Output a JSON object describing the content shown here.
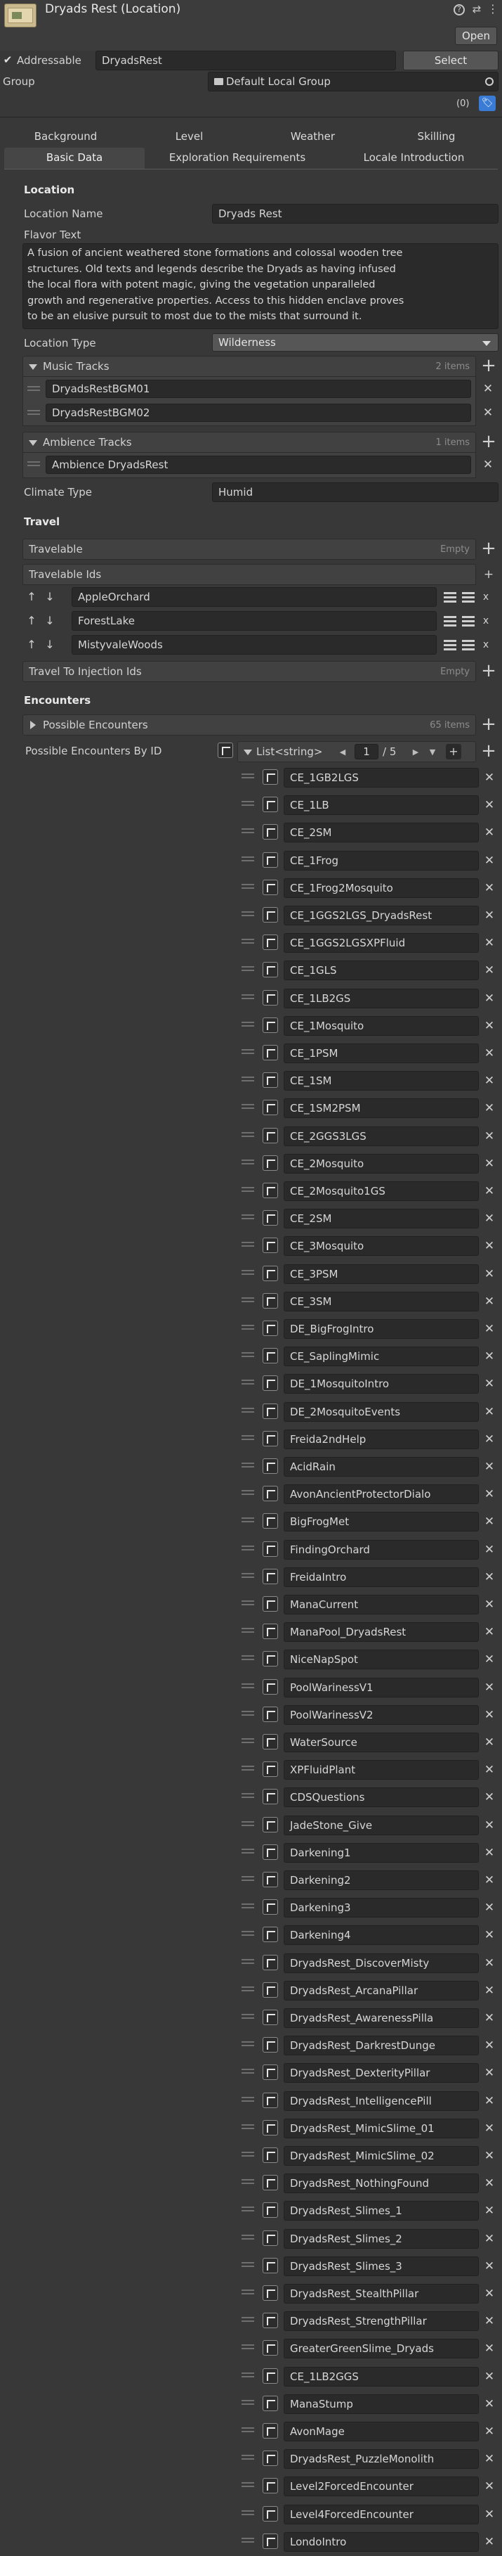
{
  "header": {
    "title": "Dryads Rest (Location)",
    "open_label": "Open"
  },
  "addressable": {
    "label": "Addressable",
    "value": "DryadsRest",
    "select_label": "Select",
    "group_label": "Group",
    "group_value": "Default Local Group",
    "badge": "(0)"
  },
  "tabs": {
    "row1": [
      "Background",
      "Level",
      "Weather",
      "Skilling"
    ],
    "row2": [
      "Basic Data",
      "Exploration Requirements",
      "Locale Introduction"
    ],
    "active": "Basic Data"
  },
  "location": {
    "header": "Location",
    "name_label": "Location Name",
    "name_value": "Dryads Rest",
    "flavor_label": "Flavor Text",
    "flavor_lines": [
      "A fusion of ancient weathered stone formations and colossal wooden tree",
      "structures. Old texts and legends describe the Dryads as having infused",
      "the local flora with potent magic, giving the vegetation unparalleled",
      "growth and regenerative properties. Access to this hidden enclave proves",
      "to be an elusive pursuit to most due to the mists that surround it."
    ],
    "type_label": "Location Type",
    "type_value": "Wilderness",
    "music_label": "Music Tracks",
    "music_count": "2 items",
    "music_items": [
      "DryadsRestBGM01",
      "DryadsRestBGM02"
    ],
    "ambience_label": "Ambience Tracks",
    "ambience_count": "1 items",
    "ambience_items": [
      "Ambience DryadsRest"
    ],
    "climate_label": "Climate Type",
    "climate_value": "Humid"
  },
  "travel": {
    "header": "Travel",
    "travelable_label": "Travelable",
    "travelable_empty": "Empty",
    "ids_label": "Travelable Ids",
    "ids": [
      "AppleOrchard",
      "ForestLake",
      "MistyvaleWoods"
    ],
    "injection_label": "Travel To Injection Ids",
    "injection_empty": "Empty"
  },
  "encounters": {
    "header": "Encounters",
    "possible_label": "Possible Encounters",
    "possible_count": "65 items",
    "by_id_label": "Possible Encounters By ID",
    "list_type": "List<string>",
    "page_current": "1",
    "page_total": "/ 5",
    "items": [
      "CE_1GB2LGS",
      "CE_1LB",
      "CE_2SM",
      "CE_1Frog",
      "CE_1Frog2Mosquito",
      "CE_1GGS2LGS_DryadsRest",
      "CE_1GGS2LGSXPFluid",
      "CE_1GLS",
      "CE_1LB2GS",
      "CE_1Mosquito",
      "CE_1PSM",
      "CE_1SM",
      "CE_1SM2PSM",
      "CE_2GGS3LGS",
      "CE_2Mosquito",
      "CE_2Mosquito1GS",
      "CE_2SM",
      "CE_3Mosquito",
      "CE_3PSM",
      "CE_3SM",
      "DE_BigFrogIntro",
      "CE_SaplingMimic",
      "DE_1MosquitoIntro",
      "DE_2MosquitoEvents",
      "Freida2ndHelp",
      "AcidRain",
      "AvonAncientProtectorDialo",
      "BigFrogMet",
      "FindingOrchard",
      "FreidaIntro",
      "ManaCurrent",
      "ManaPool_DryadsRest",
      "NiceNapSpot",
      "PoolWarinessV1",
      "PoolWarinessV2",
      "WaterSource",
      "XPFluidPlant",
      "CDSQuestions",
      "JadeStone_Give",
      "Darkening1",
      "Darkening2",
      "Darkening3",
      "Darkening4",
      "DryadsRest_DiscoverMisty",
      "DryadsRest_ArcanaPillar",
      "DryadsRest_AwarenessPilla",
      "DryadsRest_DarkrestDunge",
      "DryadsRest_DexterityPillar",
      "DryadsRest_IntelligencePill",
      "DryadsRest_MimicSlime_01",
      "DryadsRest_MimicSlime_02",
      "DryadsRest_NothingFound",
      "DryadsRest_Slimes_1",
      "DryadsRest_Slimes_2",
      "DryadsRest_Slimes_3",
      "DryadsRest_StealthPillar",
      "DryadsRest_StrengthPillar",
      "GreaterGreenSlime_Dryads",
      "CE_1LB2GGS",
      "ManaStump",
      "AvonMage",
      "DryadsRest_PuzzleMonolith",
      "Level2ForcedEncounter",
      "Level4ForcedEncounter",
      "LondoIntro"
    ]
  },
  "colors": {
    "background": "#383838",
    "field": "#2a2a2a",
    "button": "#565656",
    "accent_blue": "#3a7bd5"
  },
  "icons": [
    "location-asset-icon",
    "help-icon",
    "settings-icon",
    "menu-icon",
    "checkbox-icon",
    "folder-icon",
    "target-icon",
    "tag-icon",
    "plus-icon",
    "close-icon",
    "foldout-arrow-icon",
    "drag-handle-icon",
    "arrow-up-icon",
    "arrow-down-icon",
    "hamburger-icon",
    "row-select-icon",
    "pager-left-icon",
    "pager-right-icon",
    "dropdown-arrow-icon"
  ]
}
